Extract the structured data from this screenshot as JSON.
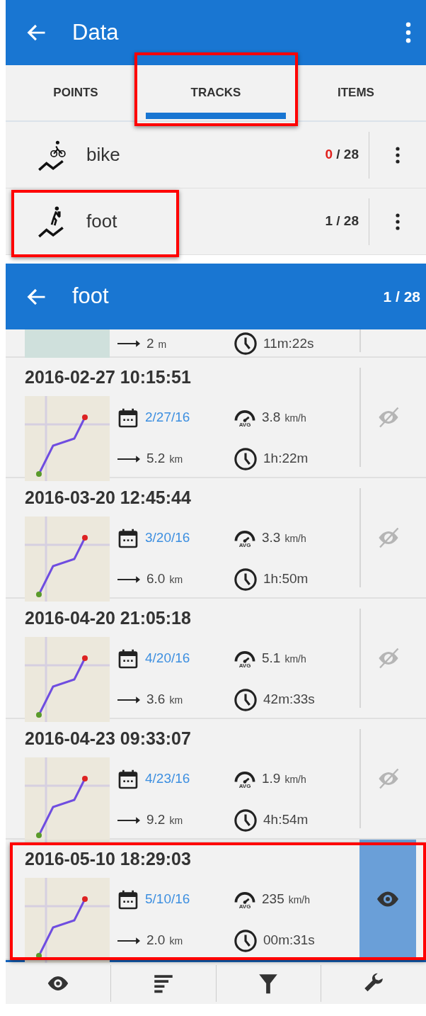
{
  "data_screen": {
    "title": "Data",
    "tabs": [
      {
        "label": "POINTS",
        "selected": false,
        "highlighted": false
      },
      {
        "label": "TRACKS",
        "selected": true,
        "highlighted": true
      },
      {
        "label": "ITEMS",
        "selected": false,
        "highlighted": false
      }
    ],
    "categories": [
      {
        "kind": "bike",
        "name": "bike",
        "visible_count": "0",
        "count_alert": true,
        "separator": "/",
        "total": "28",
        "highlighted": false
      },
      {
        "kind": "foot",
        "name": "foot",
        "visible_count": "1",
        "count_alert": false,
        "separator": "/",
        "total": "28",
        "highlighted": true
      }
    ]
  },
  "track_screen": {
    "title": "foot",
    "counter": "1 / 28",
    "tracks": [
      {
        "kind": "partial",
        "distance": "2",
        "distance_unit": "m",
        "duration": "11m:22s"
      },
      {
        "kind": "full",
        "name": "2016-02-27 10:15:51",
        "date": "2/27/16",
        "speed": "3.8",
        "speed_unit": "km/h",
        "speed_badge": "AVG",
        "distance": "5.2",
        "distance_unit": "km",
        "duration": "1h:22m",
        "visible": false,
        "highlighted": false
      },
      {
        "kind": "full",
        "name": "2016-03-20 12:45:44",
        "date": "3/20/16",
        "speed": "3.3",
        "speed_unit": "km/h",
        "speed_badge": "AVG",
        "distance": "6.0",
        "distance_unit": "km",
        "duration": "1h:50m",
        "visible": false,
        "highlighted": false
      },
      {
        "kind": "full",
        "name": "2016-04-20 21:05:18",
        "date": "4/20/16",
        "speed": "5.1",
        "speed_unit": "km/h",
        "speed_badge": "AVG",
        "distance": "3.6",
        "distance_unit": "km",
        "duration": "42m:33s",
        "visible": false,
        "highlighted": false
      },
      {
        "kind": "full",
        "name": "2016-04-23 09:33:07",
        "date": "4/23/16",
        "speed": "1.9",
        "speed_unit": "km/h",
        "speed_badge": "AVG",
        "distance": "9.2",
        "distance_unit": "km",
        "duration": "4h:54m",
        "visible": false,
        "highlighted": false
      },
      {
        "kind": "full",
        "name": "2016-05-10 18:29:03",
        "date": "5/10/16",
        "speed": "235",
        "speed_unit": "km/h",
        "speed_badge": "AVG",
        "distance": "2.0",
        "distance_unit": "km",
        "duration": "00m:31s",
        "visible": true,
        "highlighted": true
      }
    ]
  }
}
